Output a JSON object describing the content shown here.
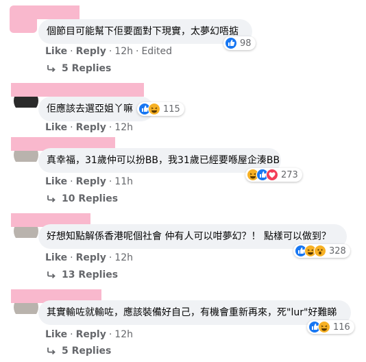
{
  "comments": [
    {
      "text": "個節目可能幫下佢要面對下現實，太夢幻唔掂",
      "reactions": [
        "like"
      ],
      "count": "98",
      "like": "Like",
      "reply": "Reply",
      "time": "12h",
      "edited": "Edited",
      "replies": "5 Replies"
    },
    {
      "text": "佢應該去選亞姐丫嘛",
      "reactions": [
        "like",
        "haha"
      ],
      "count": "115",
      "like": "Like",
      "reply": "Reply",
      "time": "12h"
    },
    {
      "text": "真幸福，31歲仲可以扮BB，我31歲已經要喺屋企湊BB",
      "reactions": [
        "haha",
        "like",
        "love"
      ],
      "count": "273",
      "like": "Like",
      "reply": "Reply",
      "time": "11h",
      "replies": "10 Replies"
    },
    {
      "text": "好想知點解係香港呢個社會 仲有人可以咁夢幻？！ 點樣可以做到？",
      "reactions": [
        "like",
        "haha",
        "wow"
      ],
      "count": "328",
      "like": "Like",
      "reply": "Reply",
      "time": "12h",
      "replies": "13 Replies"
    },
    {
      "text": "其實輸咗就輸咗，應該裝備好自己，有機會重新再來，死\"lur\"好難睇",
      "reactions": [
        "like",
        "haha"
      ],
      "count": "116",
      "like": "Like",
      "reply": "Reply",
      "time": "12h",
      "replies": "5 Replies"
    }
  ],
  "colors": {
    "bubble": "#f0f2f5",
    "redaction": "#f9b8cd",
    "meta": "#65676b",
    "like_blue": "#1877f2"
  }
}
